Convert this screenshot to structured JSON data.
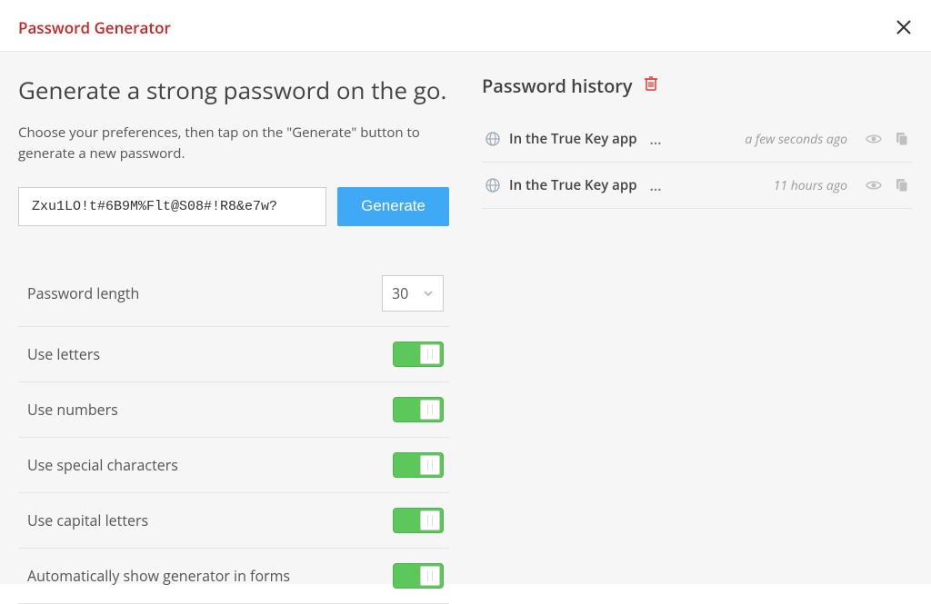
{
  "header": {
    "title": "Password Generator"
  },
  "generator": {
    "heading": "Generate a strong password on the go.",
    "subheading": "Choose your preferences, then tap on the \"Generate\" button to generate a new password.",
    "password_value": "Zxu1LO!t#6B9M%Flt@S08#!R8&e7w?",
    "generate_label": "Generate",
    "options": {
      "length_label": "Password length",
      "length_value": "30",
      "letters_label": "Use letters",
      "numbers_label": "Use numbers",
      "special_label": "Use special characters",
      "capital_label": "Use capital letters",
      "autoshow_label": "Automatically show generator in forms"
    }
  },
  "history": {
    "title": "Password history",
    "items": [
      {
        "label": "In the True Key app",
        "time": "a few seconds ago"
      },
      {
        "label": "In the True Key app",
        "time": "11 hours ago"
      }
    ]
  }
}
